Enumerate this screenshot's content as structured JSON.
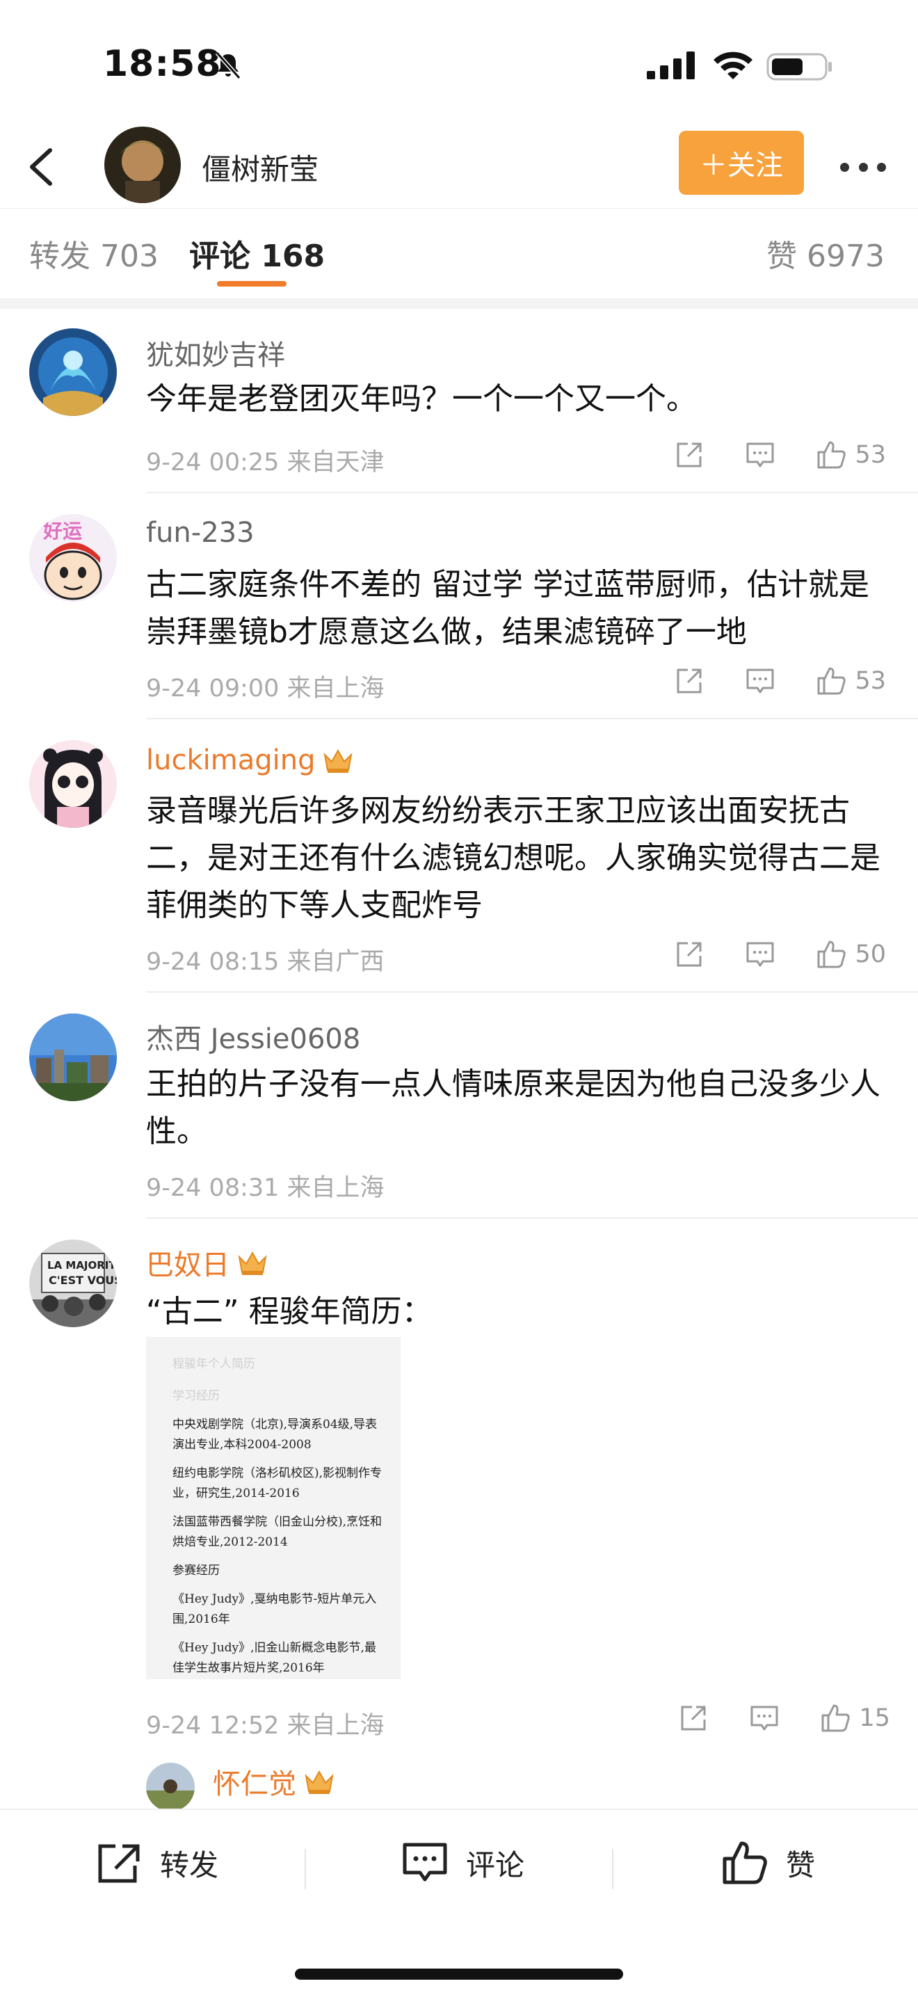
{
  "status_bar": {
    "time": "18:58"
  },
  "header": {
    "user_name": "僵树新莹",
    "follow_label": "＋关注"
  },
  "tabs": {
    "repost": "转发 703",
    "comments": "评论 168",
    "likes": "赞 6973"
  },
  "comments": [
    {
      "name": "犹如妙吉祥",
      "text": "今年是老登团灭年吗？一个一个又一个。",
      "meta": "9-24 00:25  来自天津",
      "likes": "53"
    },
    {
      "name": "fun-233",
      "text": "古二家庭条件不差的 留过学 学过蓝带厨师，估计就是崇拜墨镜b才愿意这么做，结果滤镜碎了一地",
      "meta": "9-24 09:00  来自上海",
      "likes": "53"
    },
    {
      "name": "luckimaging",
      "text": "录音曝光后许多网友纷纷表示王家卫应该出面安抚古二，是对王还有什么滤镜幻想呢。人家确实觉得古二是菲佣类的下等人支配炸号",
      "meta": "9-24 08:15  来自广西",
      "likes": "50"
    },
    {
      "name": "杰西 Jessie0608",
      "text": "王拍的片子没有一点人情味原来是因为他自己没多少人性。",
      "meta": "9-24 08:31  来自上海"
    },
    {
      "name": "巴奴日",
      "text": "“古二” 程骏年简历：",
      "meta": "9-24 12:52  来自上海",
      "likes": "15"
    },
    {
      "name": "怀仁觉"
    }
  ],
  "resume_image": {
    "faded_line": "程骏年个人简历",
    "lines": [
      "学习经历",
      "中央戏剧学院（北京),导演系04级,导表演出专业,本科2004-2008",
      "纽约电影学院（洛杉矶校区),影视制作专业，研究生,2014-2016",
      "法国蓝带西餐学院（旧金山分校),烹饪和烘焙专业,2012-2014",
      "参赛经历",
      "《Hey Judy》,戛纳电影节-短片单元入围,2016年",
      "《Hey Judy》,旧金山新概念电影节,最佳学生故事片短片奖,2016年"
    ]
  },
  "bottom_bar": {
    "repost": "转发",
    "comment": "评论",
    "like": "赞"
  },
  "colors": {
    "accent_orange": "#f7a23c",
    "vip_name": "#eb7a2b",
    "tab_underline": "#f07c2b"
  }
}
